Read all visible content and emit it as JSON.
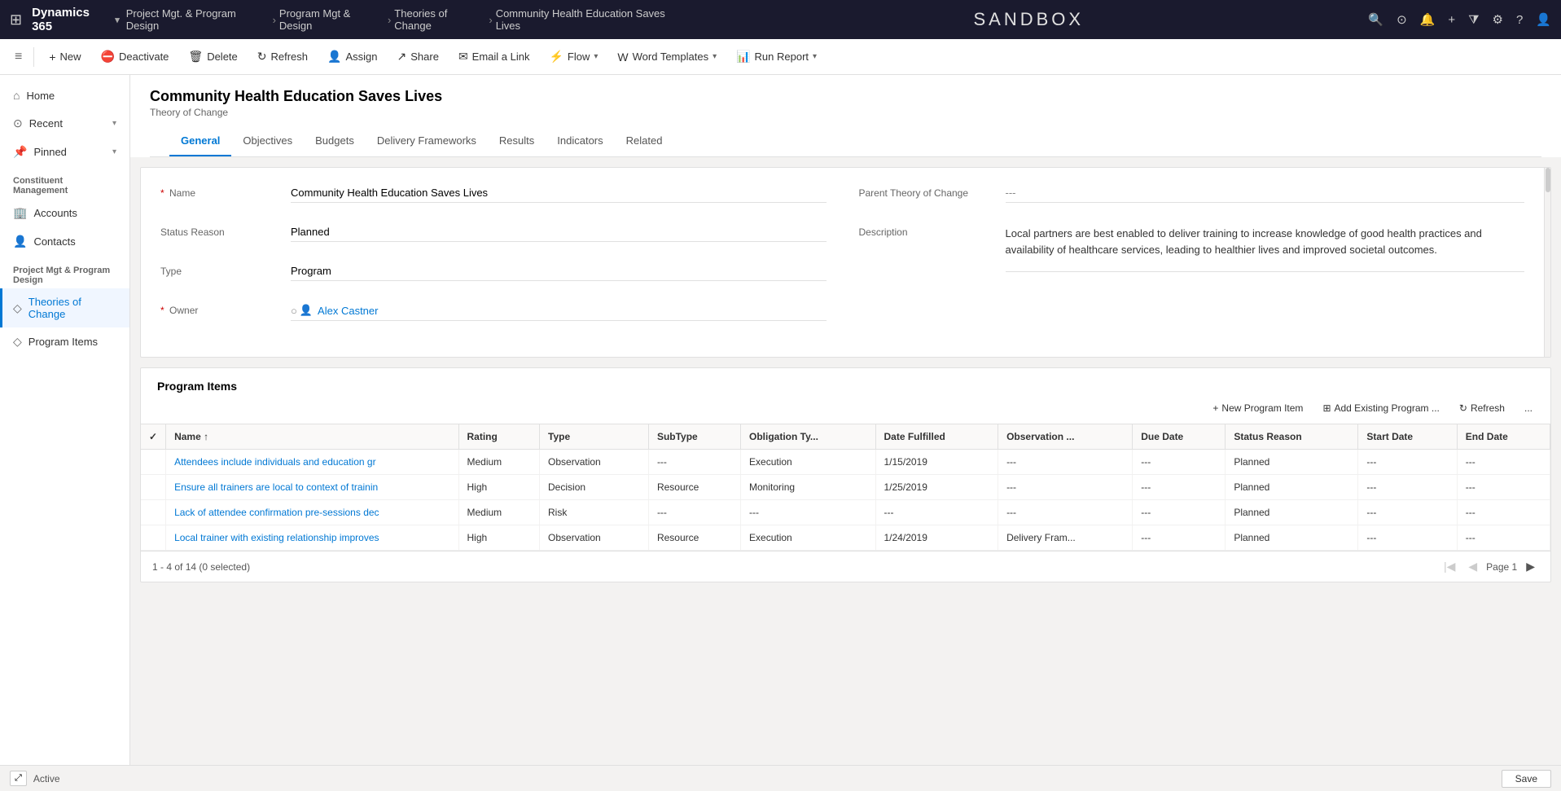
{
  "topNav": {
    "waffle": "⊞",
    "appName": "Dynamics 365",
    "breadcrumbs": [
      {
        "label": "Project Mgt. & Program Design"
      },
      {
        "label": "Program Mgt & Design"
      },
      {
        "label": "Theories of Change"
      },
      {
        "label": "Community Health Education Saves Lives"
      }
    ],
    "sandbox": "SANDBOX",
    "icons": [
      "🔍",
      "⊙",
      "🔔",
      "+",
      "🝖",
      "⚙",
      "?",
      "👤"
    ]
  },
  "commandBar": {
    "menuIcon": "≡",
    "buttons": [
      {
        "id": "new",
        "icon": "+",
        "label": "New"
      },
      {
        "id": "deactivate",
        "icon": "⛔",
        "label": "Deactivate"
      },
      {
        "id": "delete",
        "icon": "🗑",
        "label": "Delete"
      },
      {
        "id": "refresh",
        "icon": "↻",
        "label": "Refresh"
      },
      {
        "id": "assign",
        "icon": "👤",
        "label": "Assign"
      },
      {
        "id": "share",
        "icon": "↗",
        "label": "Share"
      },
      {
        "id": "email-link",
        "icon": "✉",
        "label": "Email a Link"
      },
      {
        "id": "flow",
        "icon": "⚡",
        "label": "Flow",
        "caret": true
      },
      {
        "id": "word-templates",
        "icon": "W",
        "label": "Word Templates",
        "caret": true
      },
      {
        "id": "run-report",
        "icon": "📊",
        "label": "Run Report",
        "caret": true
      }
    ]
  },
  "sidebar": {
    "items": [
      {
        "id": "home",
        "icon": "⌂",
        "label": "Home",
        "expandable": false
      },
      {
        "id": "recent",
        "icon": "⊙",
        "label": "Recent",
        "expandable": true
      },
      {
        "id": "pinned",
        "icon": "📌",
        "label": "Pinned",
        "expandable": true
      }
    ],
    "sections": [
      {
        "title": "Constituent Management",
        "items": [
          {
            "id": "accounts",
            "icon": "🏢",
            "label": "Accounts"
          },
          {
            "id": "contacts",
            "icon": "👤",
            "label": "Contacts"
          }
        ]
      },
      {
        "title": "Project Mgt & Program Design",
        "items": [
          {
            "id": "theories-of-change",
            "icon": "◇",
            "label": "Theories of Change",
            "active": true
          },
          {
            "id": "program-items",
            "icon": "◇",
            "label": "Program Items"
          }
        ]
      }
    ]
  },
  "record": {
    "title": "Community Health Education Saves Lives",
    "subtitle": "Theory of Change",
    "tabs": [
      {
        "id": "general",
        "label": "General",
        "active": true
      },
      {
        "id": "objectives",
        "label": "Objectives"
      },
      {
        "id": "budgets",
        "label": "Budgets"
      },
      {
        "id": "delivery-frameworks",
        "label": "Delivery Frameworks"
      },
      {
        "id": "results",
        "label": "Results"
      },
      {
        "id": "indicators",
        "label": "Indicators"
      },
      {
        "id": "related",
        "label": "Related"
      }
    ]
  },
  "form": {
    "fields": {
      "name": {
        "label": "Name",
        "required": true,
        "value": "Community Health Education Saves Lives"
      },
      "statusReason": {
        "label": "Status Reason",
        "value": "Planned"
      },
      "type": {
        "label": "Type",
        "value": "Program"
      },
      "owner": {
        "label": "Owner",
        "required": true,
        "value": "Alex Castner"
      },
      "parentTheory": {
        "label": "Parent Theory of Change",
        "value": "---"
      },
      "description": {
        "label": "Description",
        "value": "Local partners are best enabled to deliver training to increase knowledge of good health practices and availability of healthcare services, leading to healthier lives and improved societal outcomes."
      }
    }
  },
  "programItems": {
    "sectionTitle": "Program Items",
    "toolbar": {
      "newLabel": "New Program Item",
      "addExistingLabel": "Add Existing Program ...",
      "refreshLabel": "Refresh",
      "moreLabel": "..."
    },
    "columns": [
      {
        "id": "check",
        "label": "✓"
      },
      {
        "id": "name",
        "label": "Name",
        "sortable": true
      },
      {
        "id": "rating",
        "label": "Rating"
      },
      {
        "id": "type",
        "label": "Type"
      },
      {
        "id": "subtype",
        "label": "SubType"
      },
      {
        "id": "obligationType",
        "label": "Obligation Ty..."
      },
      {
        "id": "dateFulfilled",
        "label": "Date Fulfilled"
      },
      {
        "id": "observation",
        "label": "Observation ..."
      },
      {
        "id": "dueDate",
        "label": "Due Date"
      },
      {
        "id": "statusReason",
        "label": "Status Reason"
      },
      {
        "id": "startDate",
        "label": "Start Date"
      },
      {
        "id": "endDate",
        "label": "End Date"
      }
    ],
    "rows": [
      {
        "name": "Attendees include individuals and education gr",
        "rating": "Medium",
        "type": "Observation",
        "subtype": "---",
        "obligationType": "Execution",
        "dateFulfilled": "1/15/2019",
        "observation": "---",
        "dueDate": "---",
        "statusReason": "Planned",
        "startDate": "---",
        "endDate": "---"
      },
      {
        "name": "Ensure all trainers are local to context of trainin",
        "rating": "High",
        "type": "Decision",
        "subtype": "Resource",
        "obligationType": "Monitoring",
        "dateFulfilled": "1/25/2019",
        "observation": "---",
        "dueDate": "---",
        "statusReason": "Planned",
        "startDate": "---",
        "endDate": "---"
      },
      {
        "name": "Lack of attendee confirmation pre-sessions dec",
        "rating": "Medium",
        "type": "Risk",
        "subtype": "---",
        "obligationType": "---",
        "dateFulfilled": "---",
        "observation": "---",
        "dueDate": "---",
        "statusReason": "Planned",
        "startDate": "---",
        "endDate": "---"
      },
      {
        "name": "Local trainer with existing relationship improves",
        "rating": "High",
        "type": "Observation",
        "subtype": "Resource",
        "obligationType": "Execution",
        "dateFulfilled": "1/24/2019",
        "observation": "Delivery Fram...",
        "dueDate": "---",
        "statusReason": "Planned",
        "startDate": "---",
        "endDate": "---"
      }
    ],
    "footer": {
      "count": "1 - 4 of 14 (0 selected)",
      "pageLabel": "Page 1"
    }
  },
  "statusBar": {
    "expandIcon": "⤢",
    "status": "Active",
    "saveLabel": "Save"
  }
}
